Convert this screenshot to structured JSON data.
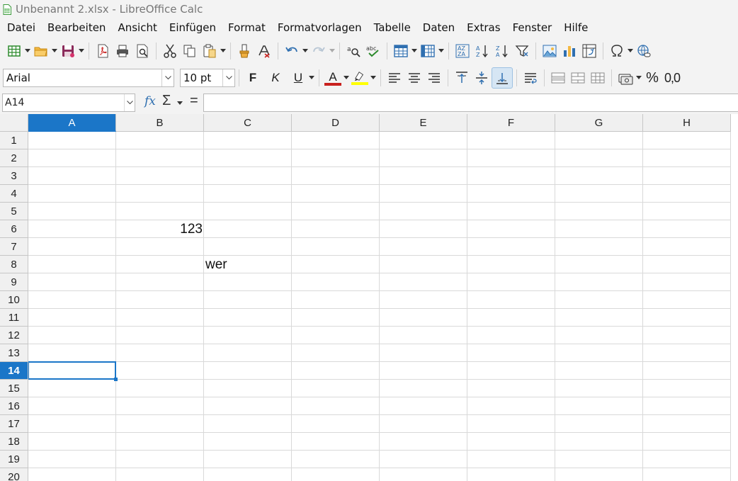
{
  "window": {
    "title": "Unbenannt 2.xlsx - LibreOffice Calc"
  },
  "menu": [
    "Datei",
    "Bearbeiten",
    "Ansicht",
    "Einfügen",
    "Format",
    "Formatvorlagen",
    "Tabelle",
    "Daten",
    "Extras",
    "Fenster",
    "Hilfe"
  ],
  "toolbar": {
    "font_name": "Arial",
    "font_size": "10 pt",
    "bold_label": "F",
    "italic_label": "K",
    "underline_label": "U",
    "font_color_label": "A",
    "font_color": "#c9211e",
    "highlight_color": "#ffff00",
    "percent_label": "%",
    "decimal_label": "0,0"
  },
  "formula_bar": {
    "name_box": "A14",
    "fx_label": "fx",
    "sum_label": "Σ",
    "equal_label": "=",
    "formula": ""
  },
  "sheet": {
    "columns": [
      "A",
      "B",
      "C",
      "D",
      "E",
      "F",
      "G",
      "H"
    ],
    "rows": [
      "1",
      "2",
      "3",
      "4",
      "5",
      "6",
      "7",
      "8",
      "9",
      "10",
      "11",
      "12",
      "13",
      "14",
      "15",
      "16",
      "17",
      "18",
      "19",
      "20"
    ],
    "selected_column": "A",
    "selected_row": "14",
    "cells": [
      {
        "ref": "B6",
        "value": "123",
        "align": "right"
      },
      {
        "ref": "C8",
        "value": "wer",
        "align": "left"
      }
    ]
  },
  "colors": {
    "accent": "#1b76c8"
  }
}
